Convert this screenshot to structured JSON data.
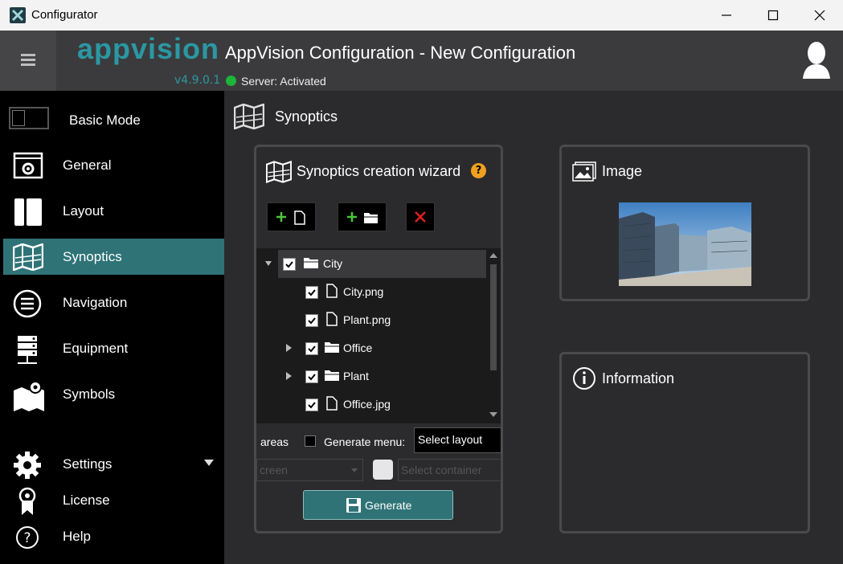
{
  "window": {
    "title": "Configurator"
  },
  "header": {
    "logo": "appvision",
    "version": "v4.9.0.1",
    "title": "AppVision Configuration - New Configuration",
    "server_status": "Server: Activated",
    "server_status_color": "#1db53a"
  },
  "sidebar": {
    "mode_label": "Basic Mode",
    "items": [
      {
        "label": "General",
        "icon": "general-icon"
      },
      {
        "label": "Layout",
        "icon": "layout-icon"
      },
      {
        "label": "Synoptics",
        "icon": "map-icon",
        "active": true
      },
      {
        "label": "Navigation",
        "icon": "menu-circle-icon"
      },
      {
        "label": "Equipment",
        "icon": "server-icon"
      },
      {
        "label": "Symbols",
        "icon": "map-pin-icon"
      },
      {
        "label": "Settings",
        "icon": "gear-icon"
      },
      {
        "label": "License",
        "icon": "license-icon"
      },
      {
        "label": "Help",
        "icon": "help-icon"
      }
    ]
  },
  "main": {
    "section_title": "Synoptics",
    "wizard": {
      "title": "Synoptics creation wizard",
      "tree": [
        {
          "label": "City",
          "type": "folder",
          "checked": true,
          "expanded": true
        },
        {
          "label": "City.png",
          "type": "file",
          "checked": true
        },
        {
          "label": "Plant.png",
          "type": "file",
          "checked": true
        },
        {
          "label": "Office",
          "type": "folder",
          "checked": true,
          "expanded": false
        },
        {
          "label": "Plant",
          "type": "folder",
          "checked": true,
          "expanded": false
        },
        {
          "label": "Office.jpg",
          "type": "file",
          "checked": true
        }
      ],
      "areas_label": "areas",
      "generate_menu_label": "Generate menu:",
      "select_layout_placeholder": "Select layout",
      "screen_value": "creen",
      "select_container_placeholder": "Select container",
      "generate_label": "Generate"
    },
    "image_panel": {
      "title": "Image"
    },
    "info_panel": {
      "title": "Information"
    }
  },
  "colors": {
    "accent": "#2f7377",
    "brand": "#2b98a3"
  }
}
